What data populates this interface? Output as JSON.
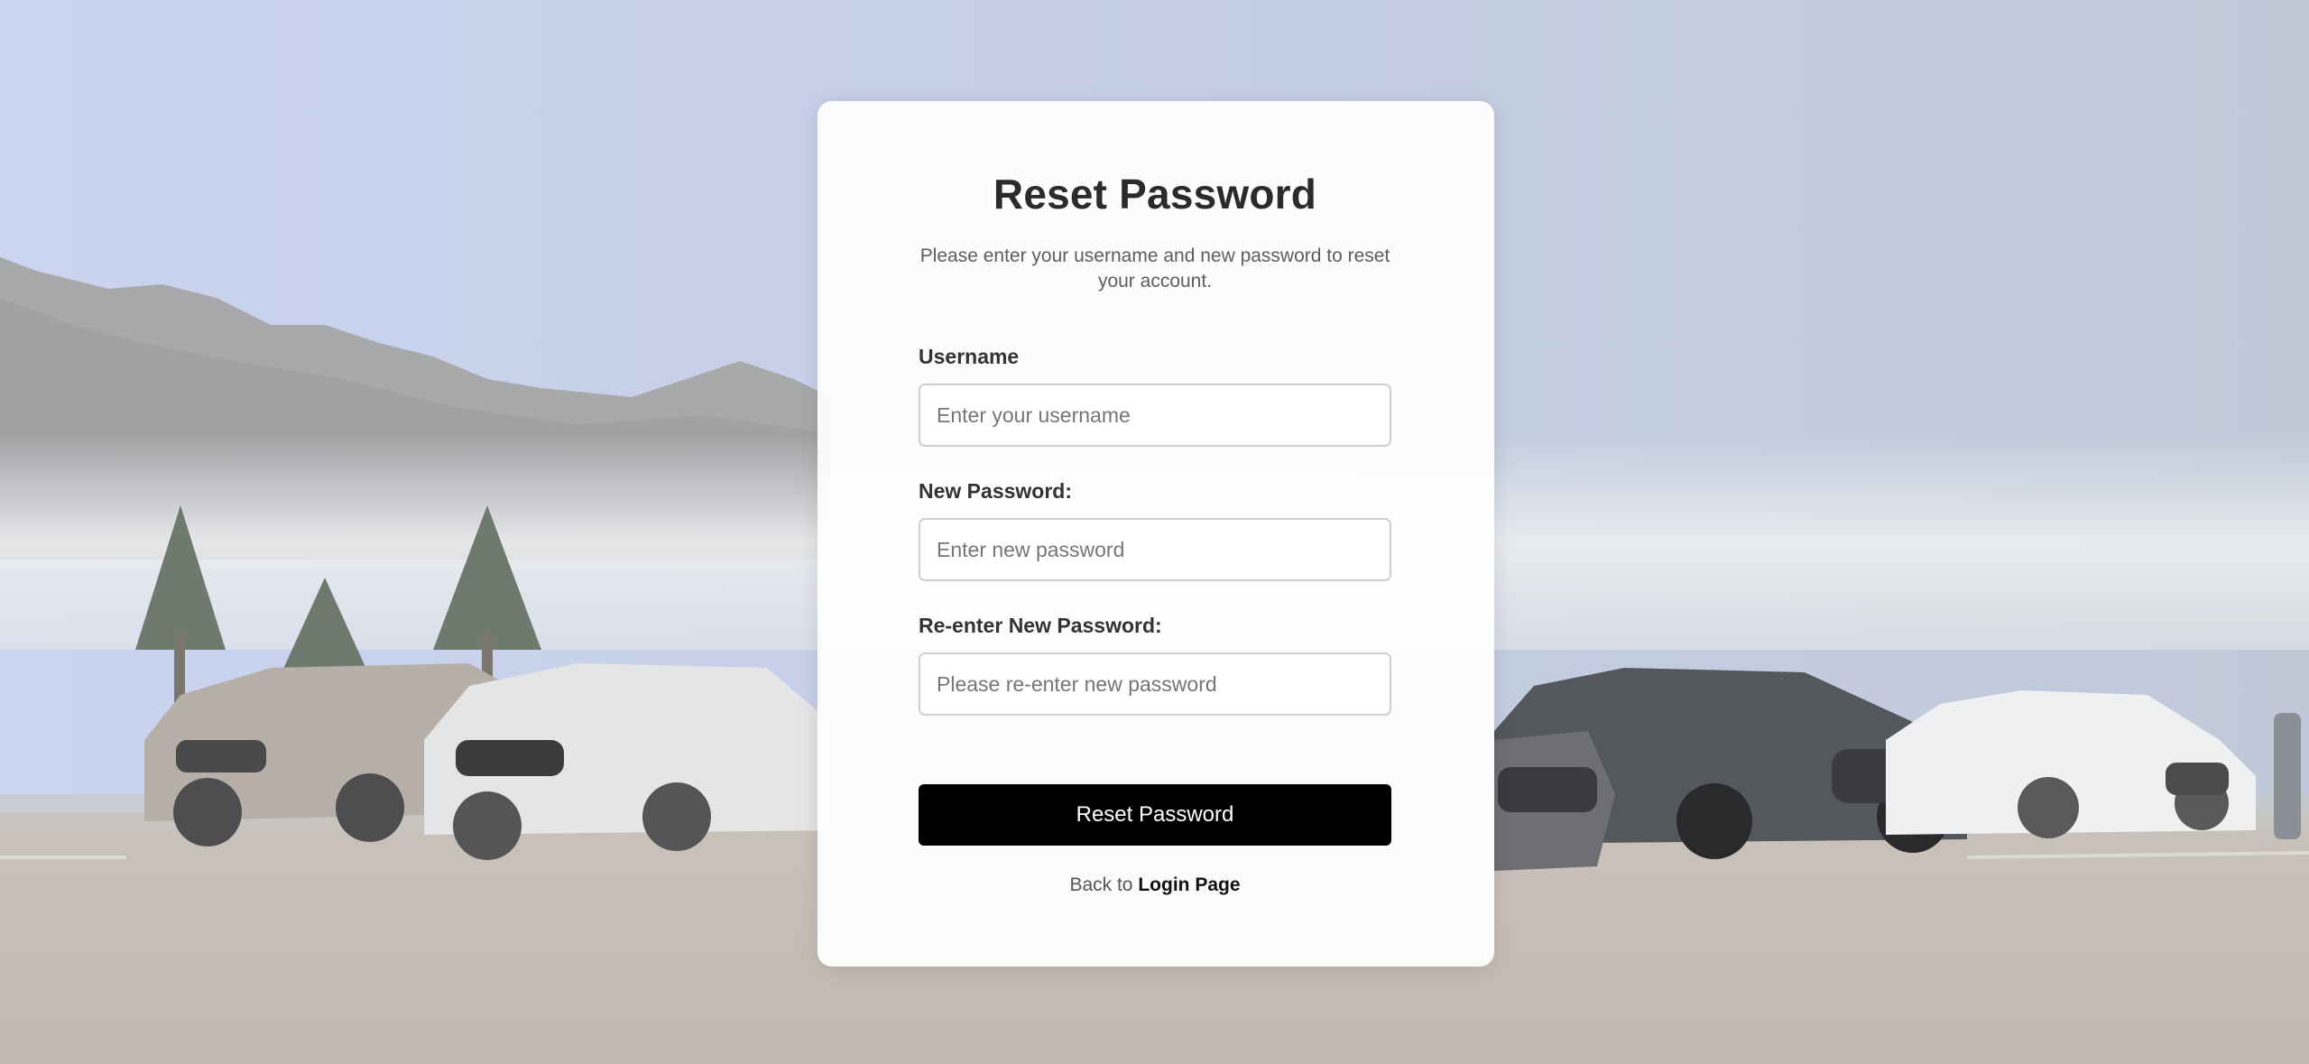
{
  "background": {
    "scene": "cars-parked-by-mountain"
  },
  "form": {
    "title": "Reset Password",
    "subtitle": "Please enter your username and new password to reset your account.",
    "username": {
      "label": "Username",
      "placeholder": "Enter your username",
      "value": ""
    },
    "new_password": {
      "label": "New Password:",
      "placeholder": "Enter new password",
      "value": ""
    },
    "confirm_password": {
      "label": "Re-enter New Password:",
      "placeholder": "Please re-enter new password",
      "value": ""
    },
    "submit_label": "Reset Password",
    "back_prefix": "Back to",
    "back_link_label": "Login Page"
  },
  "colors": {
    "button_bg": "#000000",
    "button_text": "#ffffff",
    "title": "#2b2b2b"
  }
}
